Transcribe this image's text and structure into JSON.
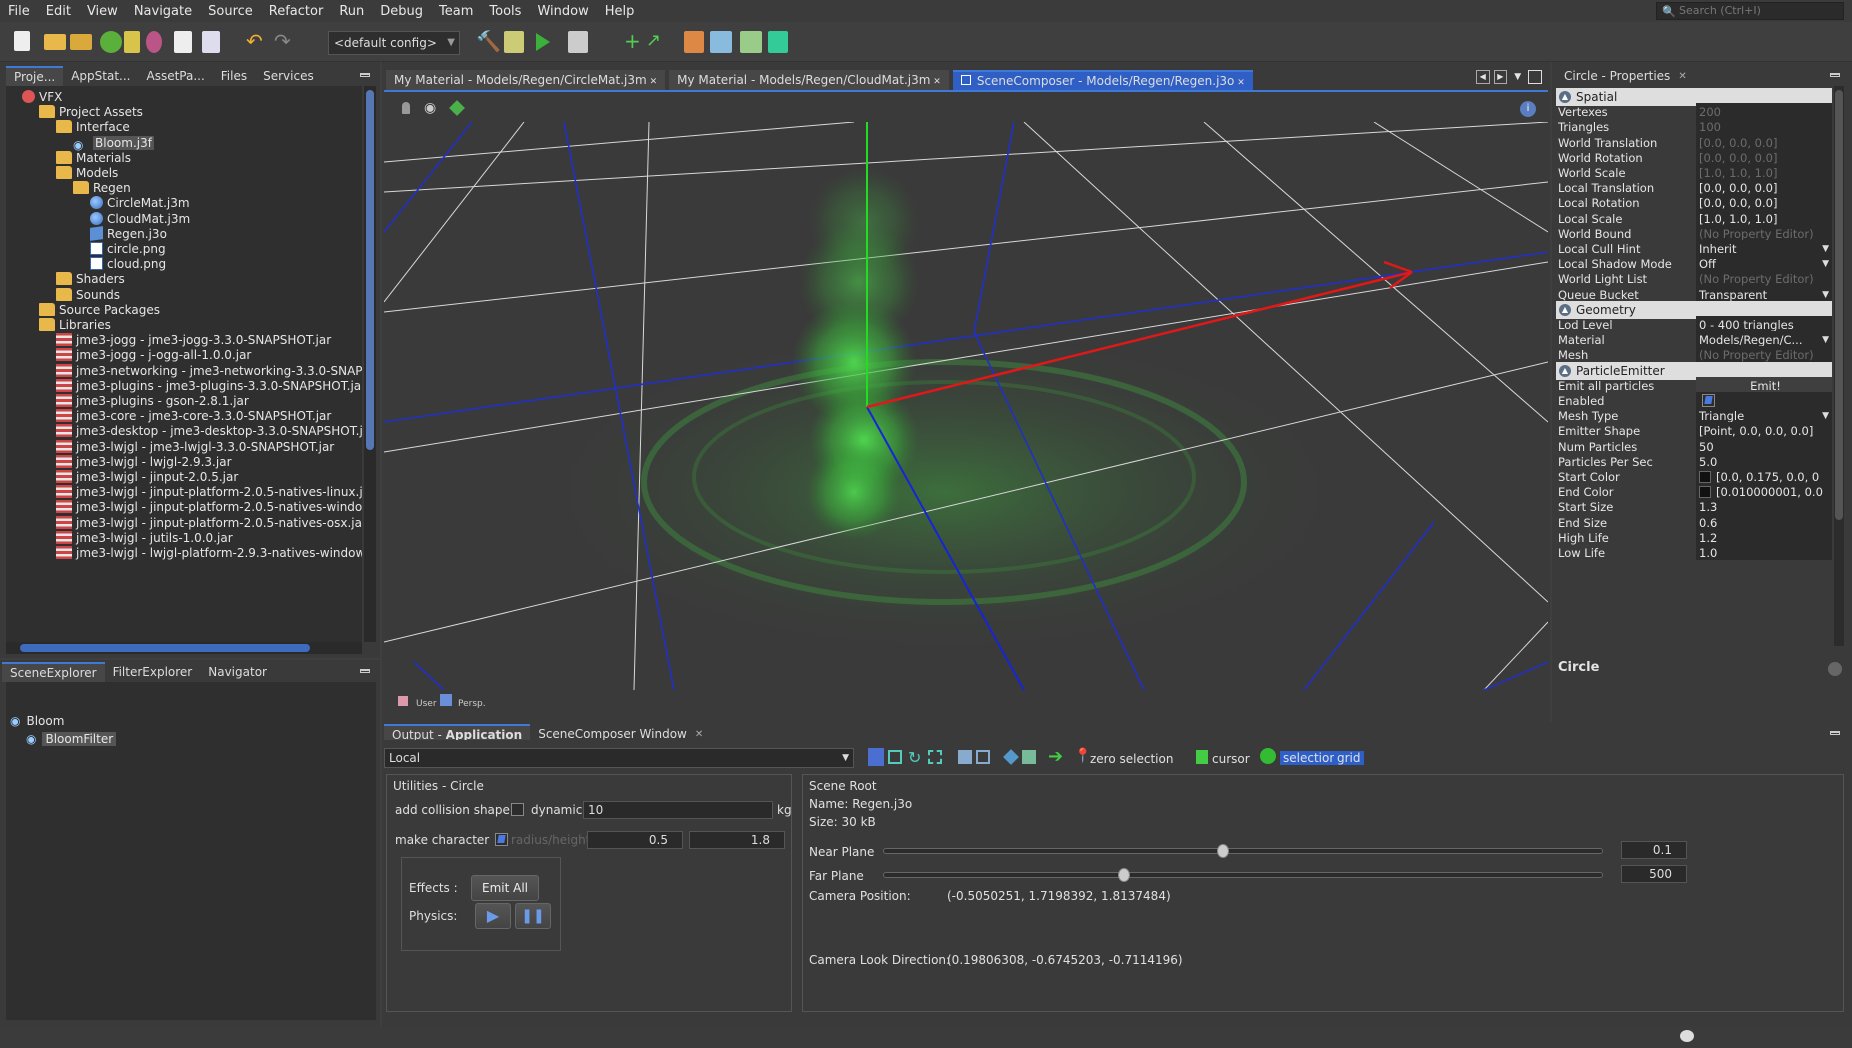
{
  "menu": [
    "File",
    "Edit",
    "View",
    "Navigate",
    "Source",
    "Refactor",
    "Run",
    "Debug",
    "Team",
    "Tools",
    "Window",
    "Help"
  ],
  "search_placeholder": "Search (Ctrl+I)",
  "config": "<default config>",
  "left_tabs": [
    "Proje...",
    "AppStat...",
    "AssetPa...",
    "Files",
    "Services"
  ],
  "tree": [
    {
      "label": "VFX",
      "depth": 0,
      "icon": "project"
    },
    {
      "label": "Project Assets",
      "depth": 1,
      "icon": "assets"
    },
    {
      "label": "Interface",
      "depth": 2,
      "icon": "folder"
    },
    {
      "label": "Bloom.j3f",
      "depth": 3,
      "icon": "filter",
      "selected": true
    },
    {
      "label": "Materials",
      "depth": 2,
      "icon": "folder"
    },
    {
      "label": "Models",
      "depth": 2,
      "icon": "folder"
    },
    {
      "label": "Regen",
      "depth": 3,
      "icon": "folder"
    },
    {
      "label": "CircleMat.j3m",
      "depth": 4,
      "icon": "material"
    },
    {
      "label": "CloudMat.j3m",
      "depth": 4,
      "icon": "material"
    },
    {
      "label": "Regen.j3o",
      "depth": 4,
      "icon": "model"
    },
    {
      "label": "circle.png",
      "depth": 4,
      "icon": "image"
    },
    {
      "label": "cloud.png",
      "depth": 4,
      "icon": "image"
    },
    {
      "label": "Shaders",
      "depth": 2,
      "icon": "folder"
    },
    {
      "label": "Sounds",
      "depth": 2,
      "icon": "folder"
    },
    {
      "label": "Source Packages",
      "depth": 1,
      "icon": "folder"
    },
    {
      "label": "Libraries",
      "depth": 1,
      "icon": "folder"
    },
    {
      "label": "jme3-jogg - jme3-jogg-3.3.0-SNAPSHOT.jar",
      "depth": 2,
      "icon": "jar"
    },
    {
      "label": "jme3-jogg - j-ogg-all-1.0.0.jar",
      "depth": 2,
      "icon": "jar"
    },
    {
      "label": "jme3-networking - jme3-networking-3.3.0-SNAPS",
      "depth": 2,
      "icon": "jar"
    },
    {
      "label": "jme3-plugins - jme3-plugins-3.3.0-SNAPSHOT.jar",
      "depth": 2,
      "icon": "jar"
    },
    {
      "label": "jme3-plugins - gson-2.8.1.jar",
      "depth": 2,
      "icon": "jar"
    },
    {
      "label": "jme3-core - jme3-core-3.3.0-SNAPSHOT.jar",
      "depth": 2,
      "icon": "jar"
    },
    {
      "label": "jme3-desktop - jme3-desktop-3.3.0-SNAPSHOT.ja",
      "depth": 2,
      "icon": "jar"
    },
    {
      "label": "jme3-lwjgl - jme3-lwjgl-3.3.0-SNAPSHOT.jar",
      "depth": 2,
      "icon": "jar"
    },
    {
      "label": "jme3-lwjgl - lwjgl-2.9.3.jar",
      "depth": 2,
      "icon": "jar"
    },
    {
      "label": "jme3-lwjgl - jinput-2.0.5.jar",
      "depth": 2,
      "icon": "jar"
    },
    {
      "label": "jme3-lwjgl - jinput-platform-2.0.5-natives-linux.ja",
      "depth": 2,
      "icon": "jar"
    },
    {
      "label": "jme3-lwjgl - jinput-platform-2.0.5-natives-window",
      "depth": 2,
      "icon": "jar"
    },
    {
      "label": "jme3-lwjgl - jinput-platform-2.0.5-natives-osx.jar",
      "depth": 2,
      "icon": "jar"
    },
    {
      "label": "jme3-lwjgl - jutils-1.0.0.jar",
      "depth": 2,
      "icon": "jar"
    },
    {
      "label": "jme3-lwjgl - lwjgl-platform-2.9.3-natives-window",
      "depth": 2,
      "icon": "jar"
    }
  ],
  "editor_tabs": [
    "My Material - Models/Regen/CircleMat.j3m",
    "My Material - Models/Regen/CloudMat.j3m",
    "SceneComposer - Models/Regen/Regen.j3o"
  ],
  "viewport_footer": {
    "user": "User",
    "persp": "Persp."
  },
  "props_title": "Circle - Properties",
  "props": [
    {
      "section": "Spatial"
    },
    {
      "k": "Vertexes",
      "v": "200",
      "dis": true
    },
    {
      "k": "Triangles",
      "v": "100",
      "dis": true
    },
    {
      "k": "World Translation",
      "v": "[0.0, 0.0, 0.0]",
      "dis": true
    },
    {
      "k": "World Rotation",
      "v": "[0.0, 0.0, 0.0]",
      "dis": true
    },
    {
      "k": "World Scale",
      "v": "[1.0, 1.0, 1.0]",
      "dis": true
    },
    {
      "k": "Local Translation",
      "v": "[0.0, 0.0, 0.0]"
    },
    {
      "k": "Local Rotation",
      "v": "[0.0, 0.0, 0.0]"
    },
    {
      "k": "Local Scale",
      "v": "[1.0, 1.0, 1.0]"
    },
    {
      "k": "World Bound",
      "v": "(No Property Editor)",
      "dis": true
    },
    {
      "k": "Local Cull Hint",
      "v": "Inherit",
      "dd": true
    },
    {
      "k": "Local Shadow Mode",
      "v": "Off",
      "dd": true
    },
    {
      "k": "World Light List",
      "v": "(No Property Editor)",
      "dis": true
    },
    {
      "k": "Queue Bucket",
      "v": "Transparent",
      "dd": true
    },
    {
      "section": "Geometry"
    },
    {
      "k": "Lod Level",
      "v": "0 - 400 triangles"
    },
    {
      "k": "Material",
      "v": "Models/Regen/C...",
      "dd": true
    },
    {
      "k": "Mesh",
      "v": "(No Property Editor)",
      "dis": true
    },
    {
      "section": "ParticleEmitter"
    },
    {
      "k": "Emit all particles",
      "v": "Emit!",
      "btn": true
    },
    {
      "k": "Enabled",
      "v": "",
      "check": true
    },
    {
      "k": "Mesh Type",
      "v": "Triangle",
      "dd": true
    },
    {
      "k": "Emitter Shape",
      "v": "[Point, 0.0, 0.0, 0.0]"
    },
    {
      "k": "Num Particles",
      "v": "50"
    },
    {
      "k": "Particles Per Sec",
      "v": "5.0"
    },
    {
      "k": "Start Color",
      "v": "[0.0, 0.175, 0.0, 0",
      "swatch": true
    },
    {
      "k": "End Color",
      "v": "[0.010000001, 0.0",
      "swatch": true
    },
    {
      "k": "Start Size",
      "v": "1.3"
    },
    {
      "k": "End Size",
      "v": "0.6"
    },
    {
      "k": "High Life",
      "v": "1.2"
    },
    {
      "k": "Low Life",
      "v": "1.0"
    }
  ],
  "prop_name": "Circle",
  "scene_tabs": [
    "SceneExplorer",
    "FilterExplorer",
    "Navigator"
  ],
  "scene_tree": [
    "Bloom",
    "BloomFilter"
  ],
  "output_tabs": [
    "Output - Application",
    "SceneComposer Window"
  ],
  "output_tab_prefix": "Output - ",
  "output_tab_name": "Application",
  "local_select": "Local",
  "tool_labels": {
    "zero": "zero selection",
    "cursor": "cursor",
    "sel": "selection",
    "grid": "grid"
  },
  "utilities": {
    "title": "Utilities - Circle",
    "collision": "add collision shape",
    "dynamic": "dynamic:",
    "dynamic_val": "10",
    "kg": "kg",
    "character": "make character",
    "radius": "radius/height",
    "r1": "0.5",
    "r2": "1.8",
    "effects": "Effects :",
    "emit_all": "Emit All",
    "physics": "Physics:"
  },
  "scene_root": {
    "title": "Scene Root",
    "name": "Name: Regen.j3o",
    "size": "Size: 30 kB",
    "near": "Near Plane",
    "near_val": "0.1",
    "far": "Far Plane",
    "far_val": "500",
    "campos_l": "Camera Position:",
    "campos": "(-0.5050251, 1.7198392, 1.8137484)",
    "camdir_l": "Camera Look Direction:",
    "camdir": "(0.19806308, -0.6745203, -0.7114196)"
  },
  "near_fraction": 0.47,
  "far_fraction": 0.33
}
